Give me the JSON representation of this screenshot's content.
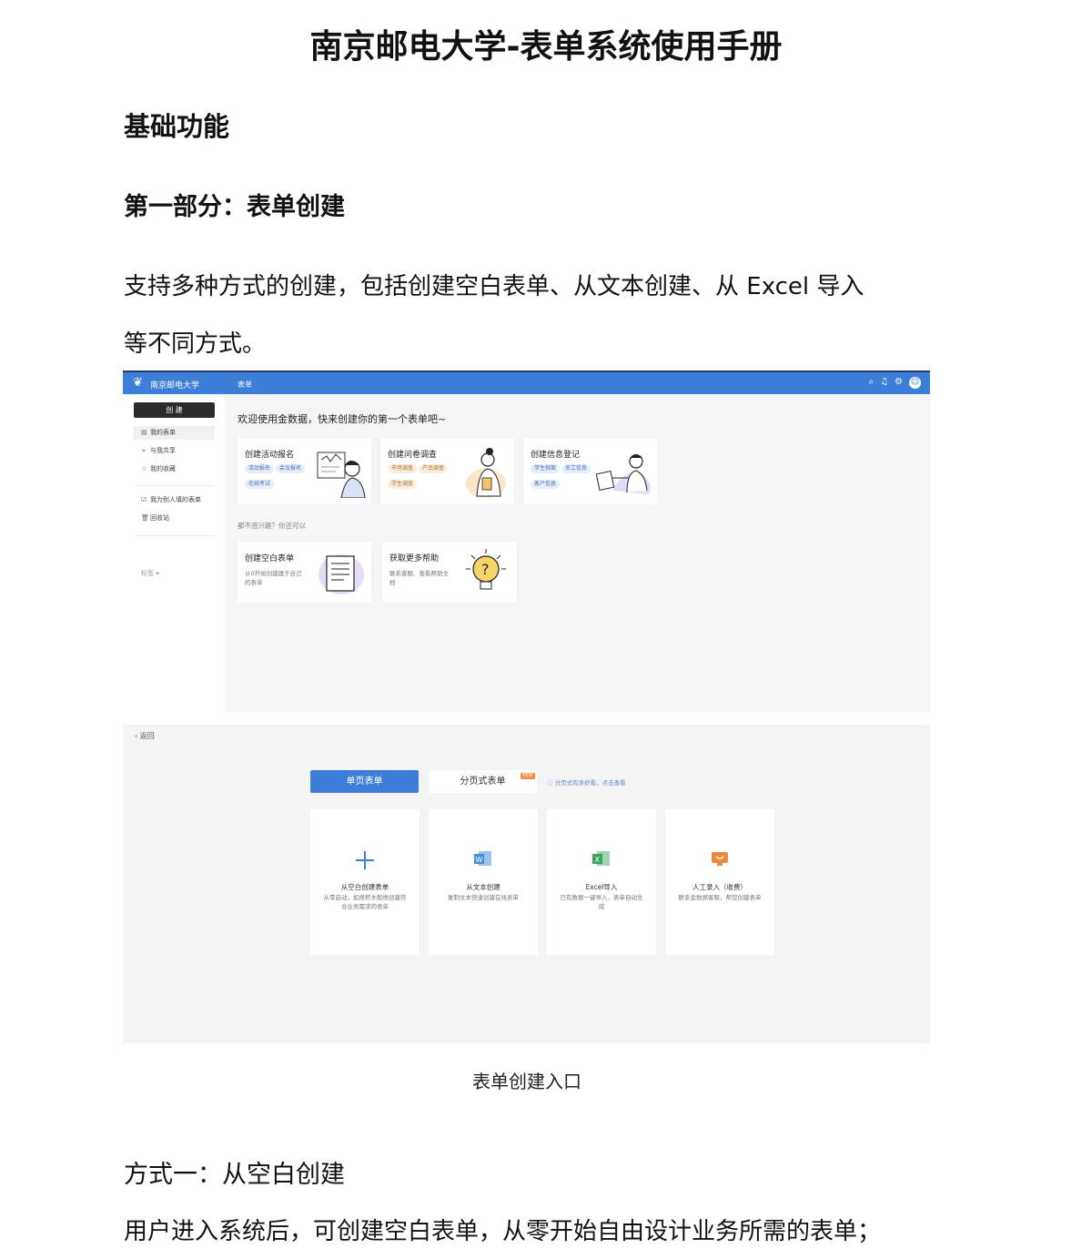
{
  "document": {
    "title": "南京邮电大学-表单系统使用手册",
    "section": "基础功能",
    "part": "第一部分：表单创建",
    "intro_line1": "支持多种方式的创建，包括创建空白表单、从文本创建、从 Excel 导入",
    "intro_line2": "等不同方式。",
    "figure_caption": "表单创建入口",
    "method_heading": "方式一：从空白创建",
    "method_text": "用户进入系统后，可创建空白表单，从零开始自由设计业务所需的表单；"
  },
  "app": {
    "brand": "南京邮电大学",
    "nav_label": "表单",
    "create_button": "创 建",
    "sidebar": {
      "items": [
        {
          "label": "我的表单",
          "icon": "document-icon"
        },
        {
          "label": "与我共享",
          "icon": "send-icon"
        },
        {
          "label": "我的收藏",
          "icon": "star-icon"
        },
        {
          "label": "我为别人填的表单",
          "icon": "checkbox-icon"
        },
        {
          "label": "回收站",
          "icon": "trash-icon"
        }
      ],
      "tag_label": "标签"
    },
    "welcome": "欢迎使用金数据，快来创建你的第一个表单吧~",
    "templates": [
      {
        "title": "创建活动报名",
        "chips": [
          "活动报名",
          "会议报名",
          "在线考试"
        ]
      },
      {
        "title": "创建问卷调查",
        "chips": [
          "市场调查",
          "产品调查",
          "学生调查"
        ]
      },
      {
        "title": "创建信息登记",
        "chips": [
          "学生档案",
          "员工信息",
          "客户信息"
        ]
      }
    ],
    "more_heading": "都不感兴趣？你还可以",
    "more": [
      {
        "title": "创建空白表单",
        "desc": "从0开始创建属于自己的表单"
      },
      {
        "title": "获取更多帮助",
        "desc": "联系客服、查看帮助文档"
      }
    ]
  },
  "create_page": {
    "back": "返回",
    "tab_single": "单页表单",
    "tab_multi": "分页式表单",
    "new_badge": "NEW",
    "tip": "分页式有多好看，点击查看",
    "options": [
      {
        "title": "从空白创建表单",
        "desc": "从零启动，如搭积木般地创建符合业务需求的表单",
        "icon": "plus-icon",
        "color": "#3d7fd8"
      },
      {
        "title": "从文本创建",
        "desc": "复制文本快速创建在线表单",
        "icon": "word-icon",
        "color": "#4a8fd6"
      },
      {
        "title": "Excel导入",
        "desc": "已有数据一键导入，表单自动生成",
        "icon": "excel-icon",
        "color": "#3fa35b"
      },
      {
        "title": "人工录入（收费）",
        "desc": "联系金数据客服，帮您创建表单",
        "icon": "service-icon",
        "color": "#ef8a3c"
      }
    ]
  }
}
